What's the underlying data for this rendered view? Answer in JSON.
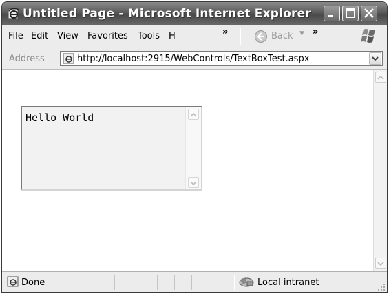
{
  "window": {
    "title": "Untitled Page - Microsoft Internet Explorer"
  },
  "menu": {
    "items": [
      "File",
      "Edit",
      "View",
      "Favorites",
      "Tools",
      "H"
    ],
    "overflow_glyph": "»",
    "back_label": "Back"
  },
  "address": {
    "label": "Address",
    "url": "http://localhost:2915/WebControls/TextBoxTest.aspx"
  },
  "page": {
    "textbox_value": "Hello World"
  },
  "status": {
    "text": "Done",
    "zone": "Local intranet"
  },
  "icons": [
    "ie-icon",
    "minimize-icon",
    "maximize-icon",
    "close-icon",
    "back-arrow-icon",
    "windows-logo-icon",
    "page-icon",
    "dropdown-arrow-icon",
    "scroll-up-icon",
    "scroll-down-icon",
    "intranet-icon",
    "resize-grip-icon"
  ],
  "colors": {
    "titlebar": "#5a5a5a",
    "chrome": "#ececec",
    "content": "#ffffff",
    "textbox_bg": "#f2f2f2"
  }
}
